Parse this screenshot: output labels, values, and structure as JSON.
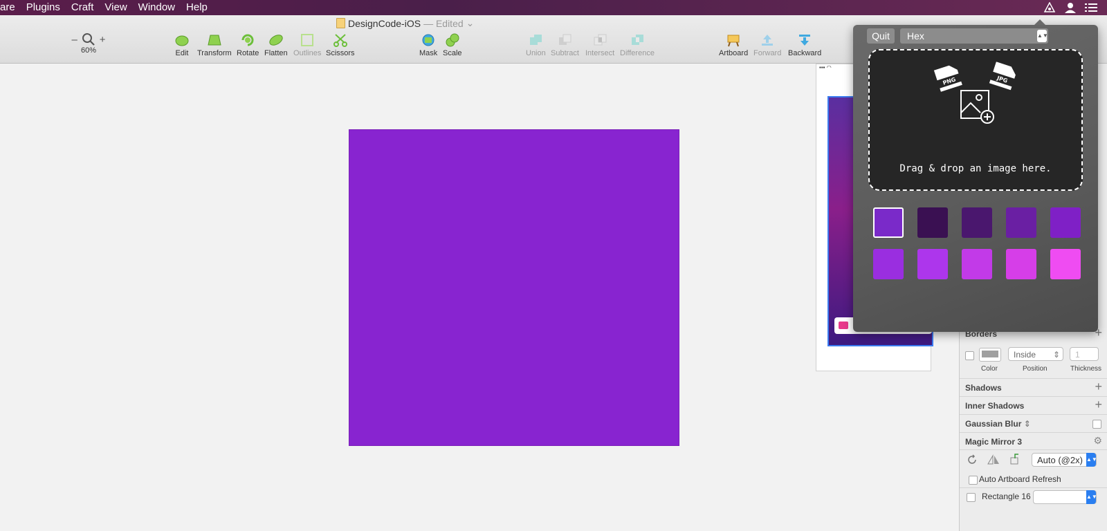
{
  "menu": [
    "are",
    "Plugins",
    "Craft",
    "View",
    "Window",
    "Help"
  ],
  "document": {
    "name": "DesignCode-iOS",
    "status": "— Edited"
  },
  "zoom": {
    "value": "60%",
    "minus": "–",
    "plus": "+"
  },
  "tools": {
    "edit": "Edit",
    "transform": "Transform",
    "rotate": "Rotate",
    "flatten": "Flatten",
    "outlines": "Outlines",
    "scissors": "Scissors",
    "mask": "Mask",
    "scale": "Scale",
    "union": "Union",
    "subtract": "Subtract",
    "intersect": "Intersect",
    "difference": "Difference",
    "artboard": "Artboard",
    "forward": "Forward",
    "backward": "Backward"
  },
  "canvas": {
    "rect_color": "#8824d0"
  },
  "popover": {
    "quit_label": "Quit",
    "format": "Hex",
    "drop_text": "Drag & drop an image here.",
    "png_label": "PNG",
    "jpg_label": "JPG",
    "swatches": [
      "#7a2ac9",
      "#3a1052",
      "#4a176e",
      "#6a1fa3",
      "#7f20c6",
      "#9a2ee0",
      "#ad36ec",
      "#c23ae8",
      "#d63ee8",
      "#ef4cf2"
    ]
  },
  "inspector": {
    "borders": "Borders",
    "border_position": "Inside",
    "border_thickness": "1",
    "color_label": "Color",
    "position_label": "Position",
    "thickness_label": "Thickness",
    "shadows": "Shadows",
    "inner_shadows": "Inner Shadows",
    "gaussian_blur": "Gaussian Blur",
    "magic_mirror": "Magic Mirror 3",
    "scale_option": "Auto (@2x)",
    "auto_refresh": "Auto Artboard Refresh",
    "layer_name": "Rectangle 16",
    "plus": "+"
  }
}
